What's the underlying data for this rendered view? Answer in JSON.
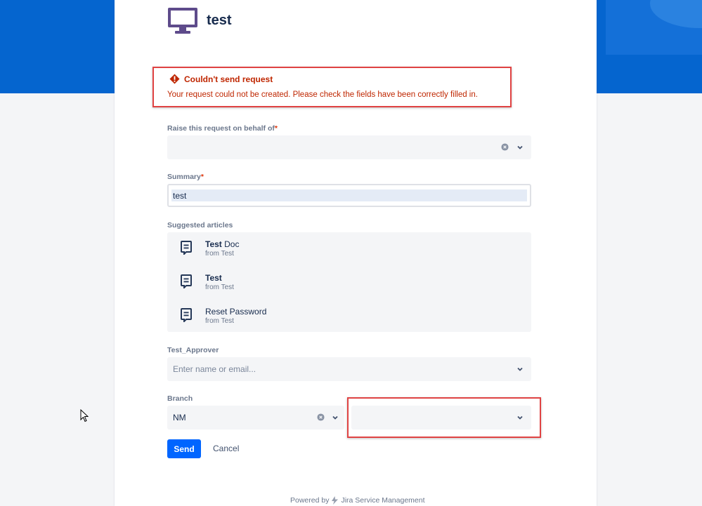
{
  "request_type": {
    "title": "test",
    "icon": "monitor-icon"
  },
  "error": {
    "title": "Couldn't send request",
    "message": "Your request could not be created. Please check the fields have been correctly filled in.",
    "icon": "error-icon",
    "color": "#bf2600"
  },
  "fields": {
    "on_behalf": {
      "label": "Raise this request on behalf of",
      "required_mark": "*",
      "value": ""
    },
    "summary": {
      "label": "Summary",
      "required_mark": "*",
      "value": "test"
    },
    "approver": {
      "label": "Test_Approver",
      "placeholder": "Enter name or email..."
    },
    "branch": {
      "label": "Branch",
      "value": "NM",
      "second_value": ""
    }
  },
  "suggested_articles": {
    "label": "Suggested articles",
    "items": [
      {
        "title_bold": "Test",
        "title_rest": " Doc",
        "source": "from Test"
      },
      {
        "title_bold": "Test",
        "title_rest": "",
        "source": "from Test"
      },
      {
        "title_bold": "",
        "title_rest": "Reset Password",
        "source": "from Test"
      }
    ]
  },
  "actions": {
    "send": "Send",
    "cancel": "Cancel"
  },
  "footer": {
    "powered_by": "Powered by",
    "product": "Jira Service Management"
  },
  "colors": {
    "brand_blue": "#0565cf",
    "primary_button": "#0065ff",
    "highlight_red": "#e04343"
  }
}
